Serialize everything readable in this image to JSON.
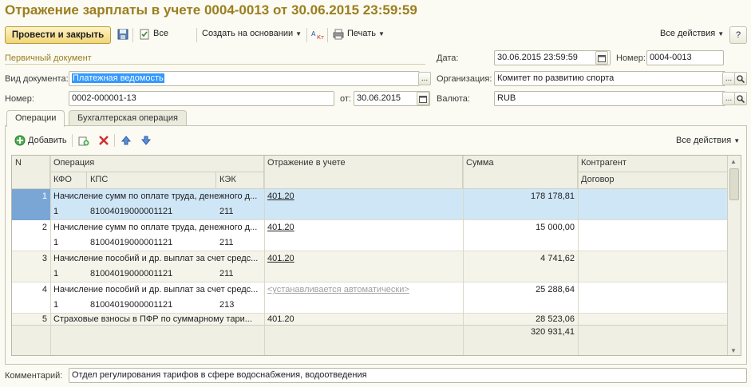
{
  "window": {
    "title": "Отражение зарплаты в учете 0004-0013 от 30.06.2015 23:59:59"
  },
  "toolbar": {
    "post_close": "Провести и закрыть",
    "all_label": "Все",
    "create_based": "Создать на основании",
    "print": "Печать",
    "all_actions": "Все действия",
    "help": "?"
  },
  "form": {
    "primary_doc_label": "Первичный документ",
    "date_label": "Дата:",
    "date_value": "30.06.2015 23:59:59",
    "number_label": "Номер:",
    "number_value": "0004-0013",
    "doc_type_label": "Вид документа:",
    "doc_type_value": "Платежная ведомость",
    "org_label": "Организация:",
    "org_value": "Комитет по развитию спорта",
    "num2_label": "Номер:",
    "num2_value": "0002-000001-13",
    "from_label": "от:",
    "from_value": "30.06.2015",
    "currency_label": "Валюта:",
    "currency_value": "RUB",
    "comment_label": "Комментарий:",
    "comment_value": "Отдел регулирования тарифов в сфере водоснабжения, водоотведения"
  },
  "tabs": [
    {
      "label": "Операции",
      "active": true
    },
    {
      "label": "Бухгалтерская операция",
      "active": false
    }
  ],
  "table_toolbar": {
    "add": "Добавить",
    "all_actions": "Все действия"
  },
  "table": {
    "headers": {
      "n": "N",
      "operation": "Операция",
      "kfo": "КФО",
      "kps": "КПС",
      "kek": "КЭК",
      "posting": "Отражение в учете",
      "amount": "Сумма",
      "counterparty": "Контрагент",
      "contract": "Договор"
    },
    "rows": [
      {
        "n": "1",
        "operation": "Начисление сумм по оплате труда, денежного д...",
        "kfo": "1",
        "kps": "81004019000001121",
        "kek": "211",
        "posting": "401.20",
        "posting_auto": false,
        "amount": "178 178,81",
        "selected": true
      },
      {
        "n": "2",
        "operation": "Начисление сумм по оплате труда, денежного д...",
        "kfo": "1",
        "kps": "81004019000001121",
        "kek": "211",
        "posting": "401.20",
        "posting_auto": false,
        "amount": "15 000,00",
        "selected": false
      },
      {
        "n": "3",
        "operation": "Начисление пособий и др. выплат за счет средс...",
        "kfo": "1",
        "kps": "81004019000001121",
        "kek": "211",
        "posting": "401.20",
        "posting_auto": false,
        "amount": "4 741,62",
        "selected": false
      },
      {
        "n": "4",
        "operation": "Начисление пособий и др. выплат за счет средс...",
        "kfo": "1",
        "kps": "81004019000001121",
        "kek": "213",
        "posting": "<устанавливается автоматически>",
        "posting_auto": true,
        "amount": "25 288,64",
        "selected": false
      },
      {
        "n": "5",
        "operation": "Страховые взносы в ПФР по суммарному тари...",
        "kfo": "",
        "kps": "",
        "kek": "",
        "posting": "401.20",
        "posting_auto": false,
        "amount": "28 523,06",
        "selected": false
      }
    ],
    "total": "320 931,41"
  },
  "colors": {
    "title": "#9b7e1f",
    "selected_row": "#cfe6f7",
    "primary_button": "#f1d577"
  }
}
